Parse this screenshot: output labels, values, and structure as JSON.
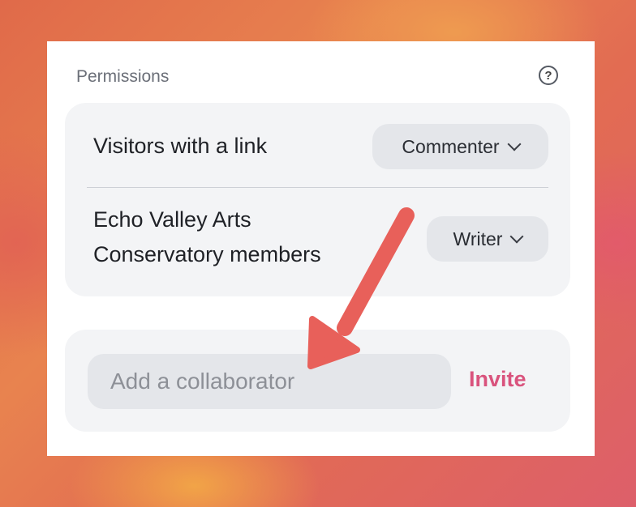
{
  "permissions": {
    "header": "Permissions",
    "help_icon": "help-circle-icon",
    "help_glyph": "?",
    "rows": [
      {
        "label": "Visitors with a link",
        "role": "Commenter"
      },
      {
        "label_line1": "Echo Valley Arts",
        "label_line2": "Conservatory members",
        "role": "Writer"
      }
    ]
  },
  "invite": {
    "placeholder": "Add a collaborator",
    "button_label": "Invite"
  },
  "colors": {
    "invite_accent": "#d9537d",
    "arrow": "#e8605a"
  }
}
